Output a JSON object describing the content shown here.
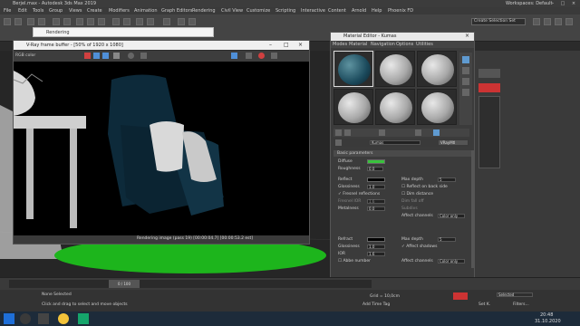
{
  "window": {
    "title": "Berjel.max - Autodesk 3ds Max 2019",
    "workspace": "Workspaces: Default"
  },
  "menus": [
    "File",
    "Edit",
    "Tools",
    "Group",
    "Views",
    "Create",
    "Modifiers",
    "Animation",
    "Graph Editors",
    "Rendering",
    "Civil View",
    "Customize",
    "Scripting",
    "Interactive",
    "Content",
    "Arnold",
    "Help",
    "Phoenix FD"
  ],
  "selection_set": "Create Selection Set",
  "rendering_window": {
    "title": "Rendering"
  },
  "vfb": {
    "title": "V-Ray frame buffer - [50% of 1920 x 1080]",
    "channel": "RGB color",
    "status": "Rendering image (pass 19) [00:00:04.7] [00:00:53.2 est]"
  },
  "material_editor": {
    "title": "Material Editor - Kumas",
    "menu": [
      "Modes",
      "Material",
      "Navigation",
      "Options",
      "Utilities"
    ],
    "name": "Kumas",
    "type": "VRayMtl",
    "rollout": "Basic parameters",
    "diffuse_label": "Diffuse",
    "diffuse_color": "#39c23c",
    "roughness_label": "Roughness",
    "roughness_value": "0.0",
    "reflect_label": "Reflect",
    "glossiness_label": "Glossiness",
    "glossiness_value": "1.0",
    "fresnel_label": "Fresnel reflections",
    "fresnel_ior_label": "Fresnel IOR",
    "fresnel_ior_value": "1.6",
    "metalness_label": "Metalness",
    "metalness_value": "0.0",
    "max_depth_label": "Max depth",
    "max_depth_value": "5",
    "reflect_back_label": "Reflect on back side",
    "dim_distance_label": "Dim distance",
    "dim_fall_off_label": "Dim fall off",
    "subdivs_label": "Subdivs",
    "affect_channels_label": "Affect channels",
    "affect_channels_value": "Color only",
    "refract_label": "Refract",
    "refract_glossiness_label": "Glossiness",
    "refract_glossiness_value": "1.0",
    "ior_label": "IOR",
    "ior_value": "1.6",
    "abbe_label": "Abbe number",
    "refract_max_depth_label": "Max depth",
    "refract_max_depth_value": "5",
    "affect_shadows_label": "Affect shadows",
    "refract_affect_label": "Affect channels",
    "refract_affect_value": "Color only"
  },
  "timeline": {
    "frame": "0 / 100"
  },
  "status": {
    "selection": "None Selected",
    "hint": "Click and drag to select and move objects",
    "grid": "Grid = 10,0cm",
    "add_time_tag": "Add Time Tag",
    "selected": "Selected",
    "set_key": "Set K.",
    "filters": "Filters..."
  },
  "clock": {
    "time": "20:48",
    "date": "31.10.2020"
  }
}
